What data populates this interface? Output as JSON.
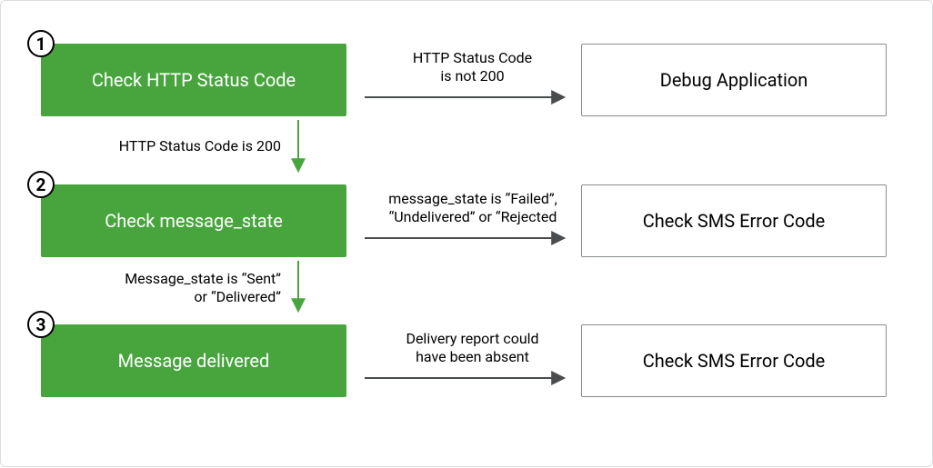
{
  "steps": [
    {
      "num": "1",
      "title": "Check HTTP Status Code",
      "right_label": "HTTP Status Code\nis not 200",
      "right_box": "Debug Application",
      "down_label": "HTTP Status Code is 200"
    },
    {
      "num": "2",
      "title": "Check message_state",
      "right_label": "message_state is “Failed”,\n“Undelivered” or “Rejected",
      "right_box": "Check SMS Error Code",
      "down_label": "Message_state is “Sent”\nor “Delivered”"
    },
    {
      "num": "3",
      "title": "Message delivered",
      "right_label": "Delivery report could\nhave been absent",
      "right_box": "Check SMS Error Code"
    }
  ],
  "colors": {
    "green": "#48a53e",
    "arrow_dark": "#4a4d4f",
    "arrow_green": "#48a53e"
  }
}
